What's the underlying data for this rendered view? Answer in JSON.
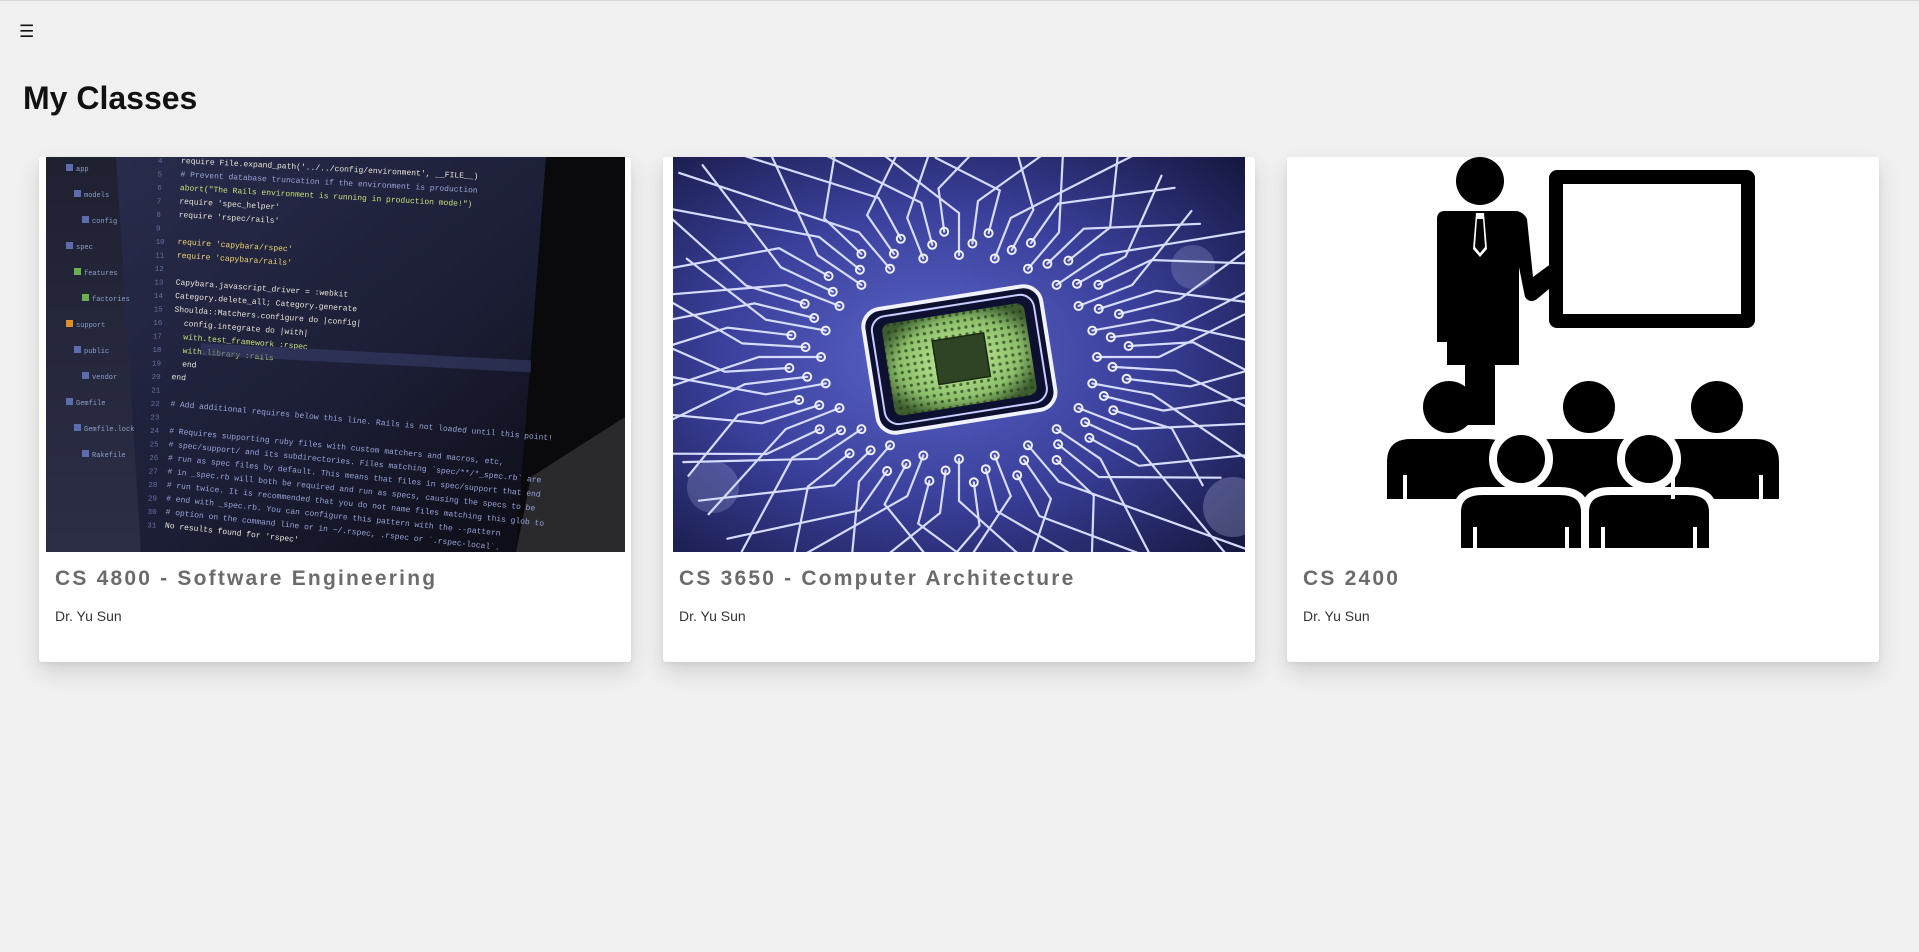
{
  "header": {
    "menu_glyph": "☰",
    "title": "My Classes"
  },
  "classes": [
    {
      "title": "CS 4800 - Software Engineering",
      "instructor": "Dr. Yu Sun",
      "image_icon": "code-laptop-photo"
    },
    {
      "title": "CS 3650 - Computer Architecture",
      "instructor": "Dr. Yu Sun",
      "image_icon": "circuit-chip-photo"
    },
    {
      "title": "CS 2400",
      "instructor": "Dr. Yu Sun",
      "image_icon": "classroom-presentation-icon"
    }
  ],
  "code_lines": [
    "require File.expand_path('../../config/environment', __FILE__)",
    "# Prevent database truncation if the environment is production",
    "abort(\"The Rails environment is running in production mode!\")",
    "require 'spec_helper'",
    "require 'rspec/rails'",
    "",
    "require 'capybara/rspec'",
    "require 'capybara/rails'",
    "",
    "Capybara.javascript_driver = :webkit",
    "Category.delete_all; Category.generate",
    "Shoulda::Matchers.configure do |config|",
    "  config.integrate do |with|",
    "    with.test_framework :rspec",
    "    with.library :rails",
    "  end",
    "end",
    "",
    "# Add additional requires below this line. Rails is not loaded until this point!",
    "",
    "# Requires supporting ruby files with custom matchers and macros, etc,",
    "# spec/support/ and its subdirectories. Files matching `spec/**/*_spec.rb` are",
    "# run as spec files by default. This means that files in spec/support that end",
    "# in _spec.rb will both be required and run as specs, causing the specs to be",
    "# run twice. It is recommended that you do not name files matching this glob to",
    "# end with _spec.rb. You can configure this pattern with the --pattern",
    "# option on the command line or in ~/.rspec, .rspec or `.rspec-local`.",
    "No results found for 'rspec'"
  ],
  "line_numbers": [
    "4",
    "5",
    "6",
    "7",
    "8",
    "9",
    "10",
    "11",
    "12",
    "13",
    "14",
    "15",
    "16",
    "17",
    "18",
    "19",
    "20",
    "21",
    "22",
    "23",
    "24",
    "25",
    "26",
    "27",
    "28",
    "29",
    "30",
    "31"
  ],
  "file_tree": [
    "app",
    "models",
    "config",
    "spec",
    "features",
    "factories",
    "support",
    "public",
    "vendor",
    "Gemfile",
    "Gemfile.lock",
    "Rakefile"
  ],
  "colors": {
    "background": "#f0f0f0",
    "card": "#ffffff",
    "title": "#6b6b6b",
    "text": "#333333",
    "heading": "#111111"
  }
}
